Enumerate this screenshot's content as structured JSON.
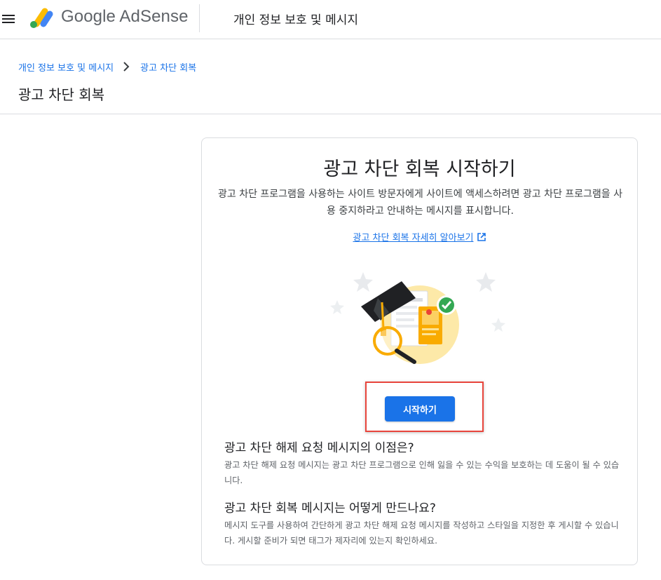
{
  "topbar": {
    "brand": "Google AdSense",
    "section_title": "개인 정보 보호 및 메시지",
    "menu_icon": "hamburger-menu-icon",
    "logo_icon": "adsense-logo-icon",
    "colors": {
      "logo_yellow": "#fbbc04",
      "logo_blue": "#4285f4",
      "logo_green": "#34a853"
    }
  },
  "breadcrumb": {
    "parent": "개인 정보 보호 및 메시지",
    "current": "광고 차단 회복",
    "separator_icon": "chevron-right-icon"
  },
  "page": {
    "title": "광고 차단 회복"
  },
  "card": {
    "title": "광고 차단 회복 시작하기",
    "description": "광고 차단 프로그램을 사용하는 사이트 방문자에게 사이트에 액세스하려면 광고 차단 프로그램을 사용 중지하라고 안내하는 메시지를 표시합니다.",
    "learn_more": "광고 차단 회복 자세히 알아보기",
    "learn_more_icon": "open-in-new-icon",
    "illustration": "ad-block-recovery-illustration",
    "cta_label": "시작하기",
    "faq": [
      {
        "question": "광고 차단 해제 요청 메시지의 이점은?",
        "answer": "광고 차단 해제 요청 메시지는 광고 차단 프로그램으로 인해 잃을 수 있는 수익을 보호하는 데 도움이 될 수 있습니다."
      },
      {
        "question": "광고 차단 회복 메시지는 어떻게 만드나요?",
        "answer": "메시지 도구를 사용하여 간단하게 광고 차단 해제 요청 메시지를 작성하고 스타일을 지정한 후 게시할 수 있습니다. 게시할 준비가 되면 태그가 제자리에 있는지 확인하세요."
      }
    ]
  },
  "colors": {
    "accent": "#1a73e8",
    "highlight": "#e8453c"
  }
}
